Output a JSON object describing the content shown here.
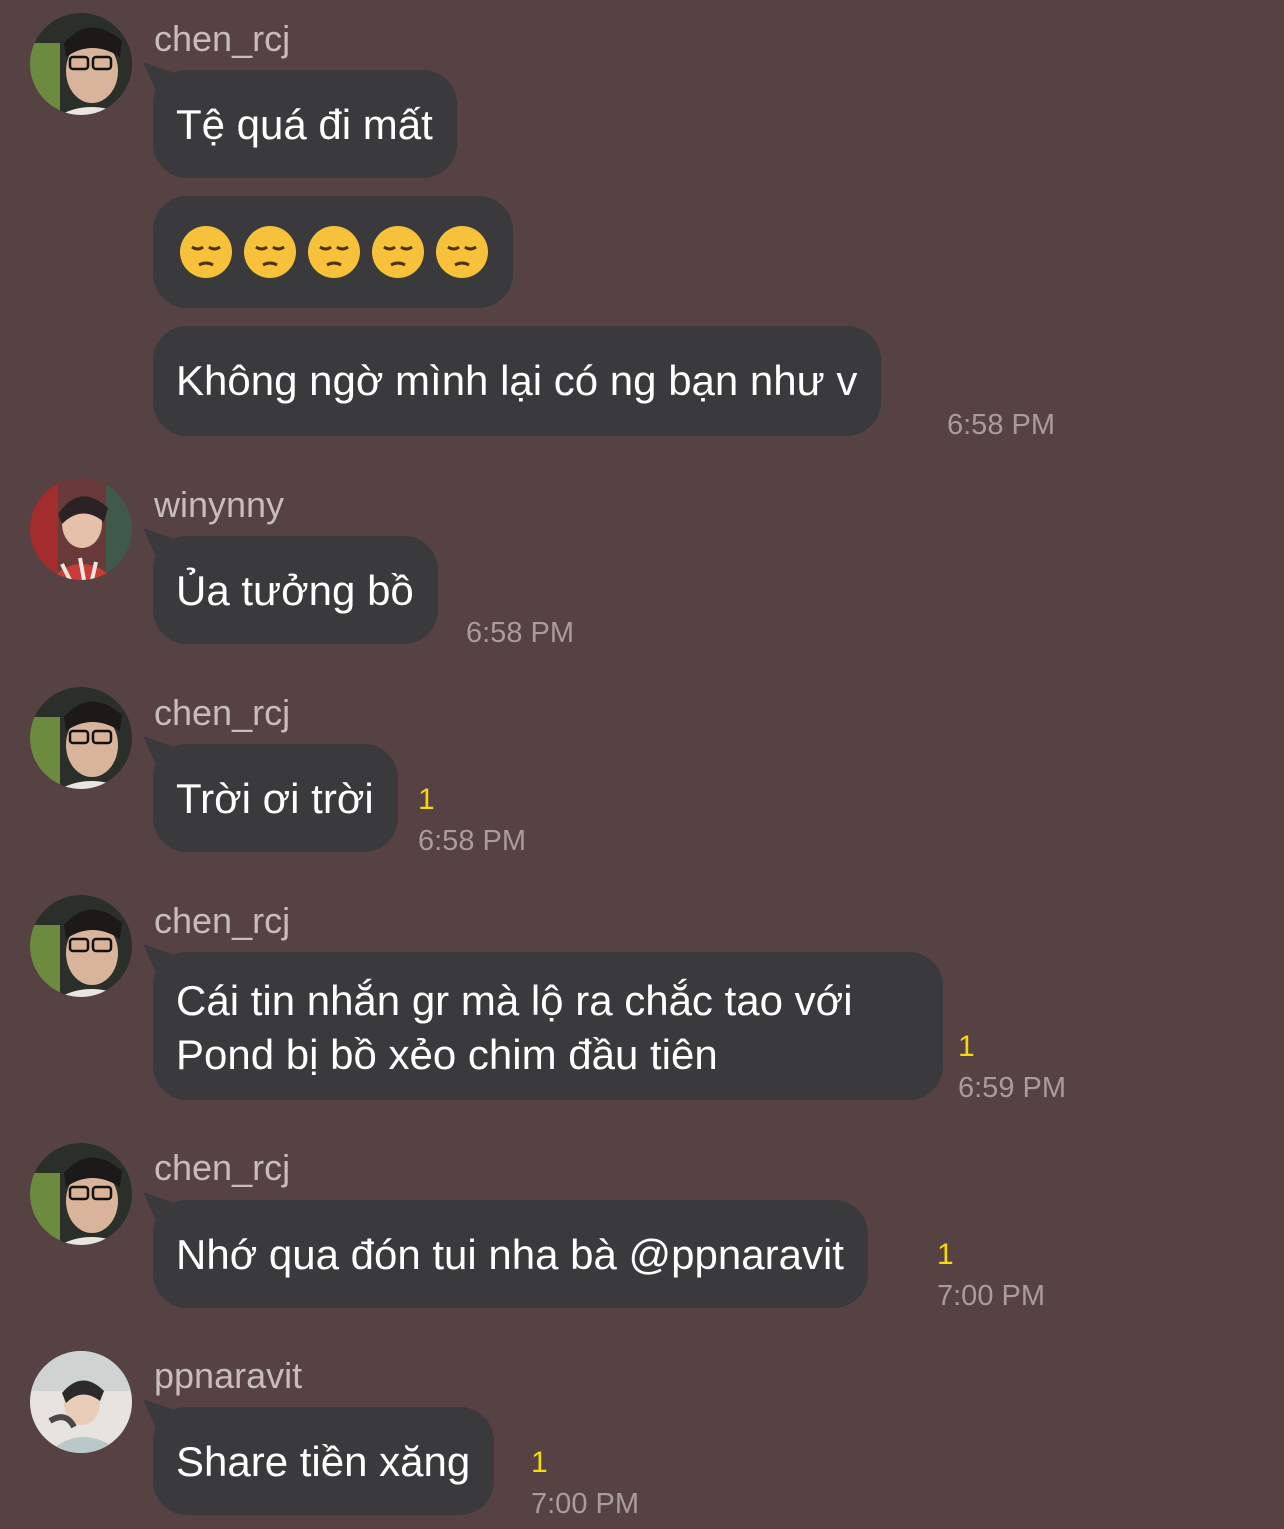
{
  "messages": [
    {
      "sender": "chen_rcj",
      "bubbles": [
        "Tệ quá đi mất",
        "😔😔😔😔😔",
        "Không ngờ mình lại có ng bạn như v"
      ],
      "time": "6:58 PM"
    },
    {
      "sender": "winynny",
      "bubbles": [
        "Ủa tưởng bồ"
      ],
      "time": "6:58 PM"
    },
    {
      "sender": "chen_rcj",
      "bubbles": [
        "Trời ơi trời"
      ],
      "unread": "1",
      "time": "6:58 PM"
    },
    {
      "sender": "chen_rcj",
      "bubbles": [
        "Cái tin nhắn gr mà lộ ra chắc tao với Pond bị bồ xẻo chim đầu tiên"
      ],
      "unread": "1",
      "time": "6:59 PM"
    },
    {
      "sender": "chen_rcj",
      "bubbles": [
        "Nhớ qua đón tui nha bà @ppnaravit"
      ],
      "unread": "1",
      "time": "7:00 PM"
    },
    {
      "sender": "ppnaravit",
      "bubbles": [
        "Share tiền xăng"
      ],
      "unread": "1",
      "time": "7:00 PM"
    }
  ],
  "colors": {
    "background": "#564243",
    "bubble": "#3a3a3c",
    "unread": "#f5d90a"
  }
}
